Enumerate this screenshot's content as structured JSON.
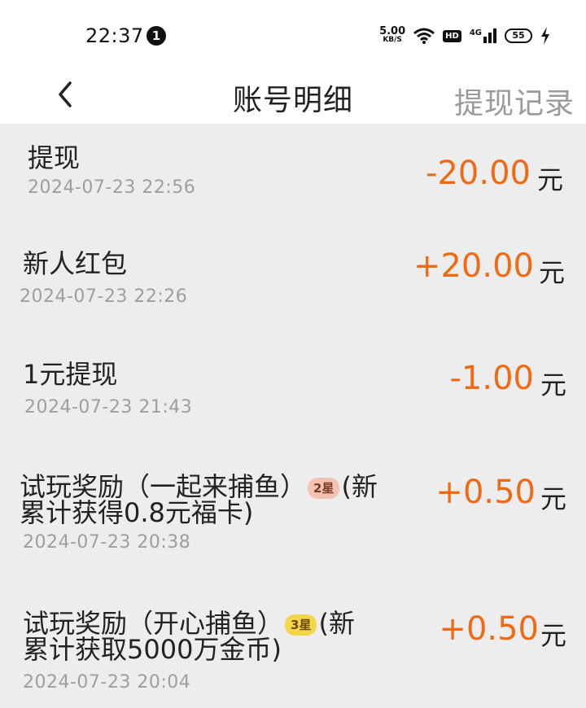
{
  "status": {
    "time": "22:37",
    "notif_count": "1",
    "speed_value": "5.00",
    "speed_unit": "KB/S",
    "hd": "HD",
    "network": "4G",
    "battery": "55"
  },
  "header": {
    "title": "账号明细",
    "withdraw_record": "提现记录"
  },
  "currency_unit": "元",
  "items": [
    {
      "title": "提现",
      "time": "2024-07-23  22:56",
      "amount": "-20.00"
    },
    {
      "title": "新人红包",
      "time": "2024-07-23  22:26",
      "amount": "+20.00"
    },
    {
      "title": "1元提现",
      "time": "2024-07-23  21:43",
      "amount": "-1.00"
    },
    {
      "title_a": "试玩奖励（一起来捕鱼）",
      "star": "2星",
      "title_b": "(新",
      "title_line2": "累计获得0.8元福卡)",
      "time": "2024-07-23  20:38",
      "amount": "+0.50"
    },
    {
      "title_a": "试玩奖励（开心捕鱼）",
      "star": "3星",
      "title_b": "(新",
      "title_line2": "累计获取5000万金币)",
      "time": "2024-07-23  20:04",
      "amount": "+0.50"
    }
  ]
}
